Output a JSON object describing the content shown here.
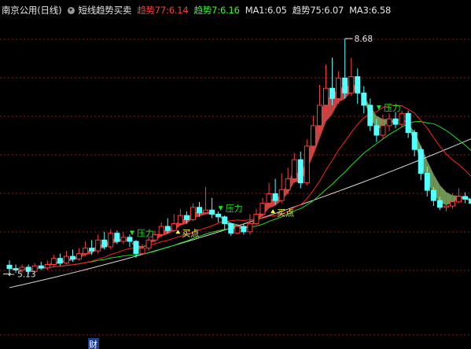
{
  "header": {
    "stock_name": "南京公用",
    "period": "(日线)",
    "indicator_name": "短线趋势买卖",
    "items": [
      {
        "label": "趋势77:",
        "value": "6.14",
        "color": "#ff3b3b"
      },
      {
        "label": "趋势7:",
        "value": "6.16",
        "color": "#2fff2f"
      },
      {
        "label": "MA1:",
        "value": "6.05",
        "color": "#e6e6e6"
      },
      {
        "label": "趋势75:",
        "value": "6.07",
        "color": "#e6e6e6"
      },
      {
        "label": "MA3:",
        "value": "6.58",
        "color": "#e6e6e6"
      }
    ]
  },
  "footer": {
    "marker": "财"
  },
  "colors": {
    "up": "#ff3b3b",
    "down": "#54ffff",
    "ribbon_up": "#d94a4a",
    "ribbon_down": "#7aa35c",
    "ma_red": "#ff2020",
    "ma_green": "#22dd22",
    "ma_white": "#d8d8d8",
    "grid": "#a01010",
    "signal": "#ffff40"
  },
  "chart_data": {
    "type": "candlestick",
    "yrange": [
      4.95,
      8.9
    ],
    "high_label": "8.68",
    "low_label": "5.13",
    "annotations": [
      {
        "text": "压力",
        "kind": "sell",
        "index": 20
      },
      {
        "text": "买点",
        "kind": "buy",
        "index": 27
      },
      {
        "text": "压力",
        "kind": "sell",
        "index": 34
      },
      {
        "text": "买点",
        "kind": "buy",
        "index": 42
      },
      {
        "text": "压力",
        "kind": "sell",
        "index": 59
      }
    ],
    "candles": [
      [
        5.35,
        5.3,
        5.42,
        5.22
      ],
      [
        5.3,
        5.28,
        5.36,
        5.24
      ],
      [
        5.28,
        5.32,
        5.36,
        5.24
      ],
      [
        5.32,
        5.26,
        5.36,
        5.22
      ],
      [
        5.26,
        5.34,
        5.38,
        5.24
      ],
      [
        5.34,
        5.31,
        5.4,
        5.28
      ],
      [
        5.31,
        5.36,
        5.42,
        5.28
      ],
      [
        5.36,
        5.45,
        5.5,
        5.32
      ],
      [
        5.45,
        5.38,
        5.52,
        5.34
      ],
      [
        5.38,
        5.48,
        5.56,
        5.36
      ],
      [
        5.48,
        5.44,
        5.58,
        5.4
      ],
      [
        5.44,
        5.52,
        5.6,
        5.42
      ],
      [
        5.52,
        5.6,
        5.7,
        5.48
      ],
      [
        5.6,
        5.56,
        5.72,
        5.5
      ],
      [
        5.56,
        5.72,
        5.8,
        5.52
      ],
      [
        5.72,
        5.62,
        5.84,
        5.58
      ],
      [
        5.62,
        5.82,
        5.88,
        5.58
      ],
      [
        5.82,
        5.7,
        5.86,
        5.66
      ],
      [
        5.7,
        5.76,
        5.84,
        5.66
      ],
      [
        5.76,
        5.7,
        5.8,
        5.62
      ],
      [
        5.7,
        5.52,
        5.72,
        5.46
      ],
      [
        5.52,
        5.6,
        5.66,
        5.5
      ],
      [
        5.6,
        5.72,
        5.78,
        5.56
      ],
      [
        5.72,
        5.8,
        5.86,
        5.68
      ],
      [
        5.8,
        5.92,
        5.98,
        5.76
      ],
      [
        5.92,
        5.86,
        6.04,
        5.82
      ],
      [
        5.86,
        5.96,
        6.1,
        5.84
      ],
      [
        5.96,
        6.08,
        6.18,
        5.94
      ],
      [
        6.08,
        6.02,
        6.14,
        5.96
      ],
      [
        6.02,
        6.2,
        6.26,
        6.0
      ],
      [
        6.2,
        6.12,
        6.28,
        6.06
      ],
      [
        6.12,
        6.16,
        6.5,
        6.1
      ],
      [
        6.16,
        6.1,
        6.34,
        6.04
      ],
      [
        6.1,
        6.06,
        6.14,
        5.98
      ],
      [
        6.06,
        5.96,
        6.08,
        5.88
      ],
      [
        5.96,
        5.82,
        5.98,
        5.78
      ],
      [
        5.82,
        5.92,
        5.96,
        5.8
      ],
      [
        5.92,
        5.84,
        5.96,
        5.8
      ],
      [
        5.84,
        5.96,
        6.1,
        5.8
      ],
      [
        5.96,
        6.1,
        6.18,
        5.94
      ],
      [
        6.1,
        6.26,
        6.34,
        6.06
      ],
      [
        6.26,
        6.4,
        6.56,
        6.22
      ],
      [
        6.4,
        6.3,
        6.62,
        6.24
      ],
      [
        6.3,
        6.46,
        6.7,
        6.26
      ],
      [
        6.46,
        6.62,
        6.78,
        6.4
      ],
      [
        6.62,
        6.9,
        7.0,
        6.56
      ],
      [
        6.9,
        6.56,
        7.02,
        6.48
      ],
      [
        6.56,
        7.1,
        7.2,
        6.52
      ],
      [
        7.1,
        7.4,
        7.55,
        7.0
      ],
      [
        7.4,
        7.7,
        8.0,
        7.3
      ],
      [
        7.7,
        7.95,
        8.3,
        7.6
      ],
      [
        7.95,
        7.8,
        8.4,
        7.7
      ],
      [
        7.8,
        8.1,
        8.2,
        7.72
      ],
      [
        8.1,
        7.88,
        8.68,
        7.8
      ],
      [
        7.88,
        8.12,
        8.4,
        7.84
      ],
      [
        8.12,
        7.88,
        8.24,
        7.72
      ],
      [
        7.88,
        7.7,
        7.98,
        7.58
      ],
      [
        7.7,
        7.4,
        7.8,
        7.32
      ],
      [
        7.4,
        7.26,
        7.5,
        7.16
      ],
      [
        7.26,
        7.4,
        7.56,
        7.2
      ],
      [
        7.4,
        7.5,
        7.58,
        7.32
      ],
      [
        7.5,
        7.42,
        7.6,
        7.36
      ],
      [
        7.42,
        7.58,
        7.62,
        7.38
      ],
      [
        7.58,
        7.3,
        7.62,
        7.22
      ],
      [
        7.3,
        7.05,
        7.34,
        6.95
      ],
      [
        7.05,
        6.7,
        7.1,
        6.6
      ],
      [
        6.7,
        6.45,
        6.8,
        6.36
      ],
      [
        6.45,
        6.3,
        6.5,
        6.22
      ],
      [
        6.3,
        6.2,
        6.36,
        6.16
      ],
      [
        6.2,
        6.22,
        6.3,
        6.14
      ],
      [
        6.22,
        6.28,
        6.4,
        6.18
      ],
      [
        6.28,
        6.36,
        6.48,
        6.26
      ],
      [
        6.36,
        6.32,
        6.42,
        6.26
      ],
      [
        6.32,
        6.26,
        6.36,
        6.2
      ]
    ]
  }
}
